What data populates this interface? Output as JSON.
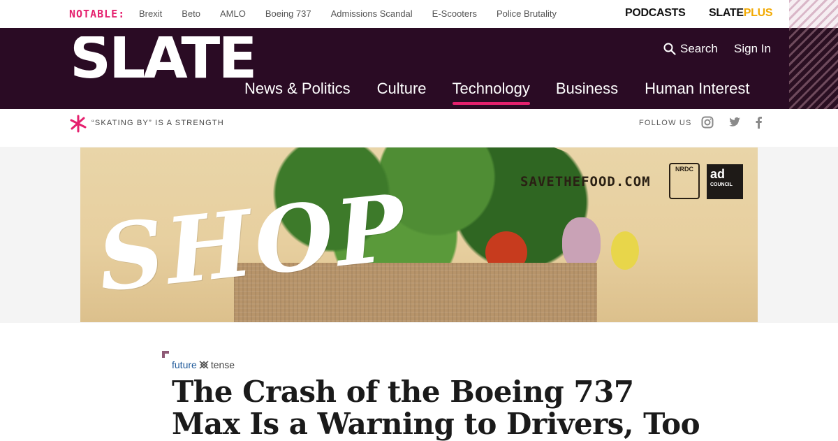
{
  "topbar": {
    "notable_label": "NOTABLE:",
    "topics": [
      "Brexit",
      "Beto",
      "AMLO",
      "Boeing 737",
      "Admissions Scandal",
      "E-Scooters",
      "Police Brutality"
    ],
    "podcasts_label": "PODCASTS",
    "slateplus_part1": "SLATE",
    "slateplus_part2": "PLUS"
  },
  "header": {
    "logo_text": "SLATE",
    "search_label": "Search",
    "signin_label": "Sign In",
    "nav": [
      "News & Politics",
      "Culture",
      "Technology",
      "Business",
      "Human Interest"
    ],
    "active_nav": "Technology"
  },
  "subbar": {
    "tagline": "“SKATING BY” IS A STRENGTH",
    "follow_label": "FOLLOW US"
  },
  "ad": {
    "headline": "SHOP",
    "url": "SAVETHEFOOD.COM",
    "nrdc_label": "NRDC",
    "adcouncil_label": "ad",
    "adcouncil_sub": "COUNCIL"
  },
  "article": {
    "section_part1": "future",
    "section_part2": "tense",
    "headline": "The Crash of the Boeing 737 Max Is a Warning to Drivers, Too"
  },
  "colors": {
    "accent": "#e5206e",
    "header_bg": "#2a0b24",
    "plus_gold": "#f2a900",
    "section_blue": "#1f5a9a"
  }
}
